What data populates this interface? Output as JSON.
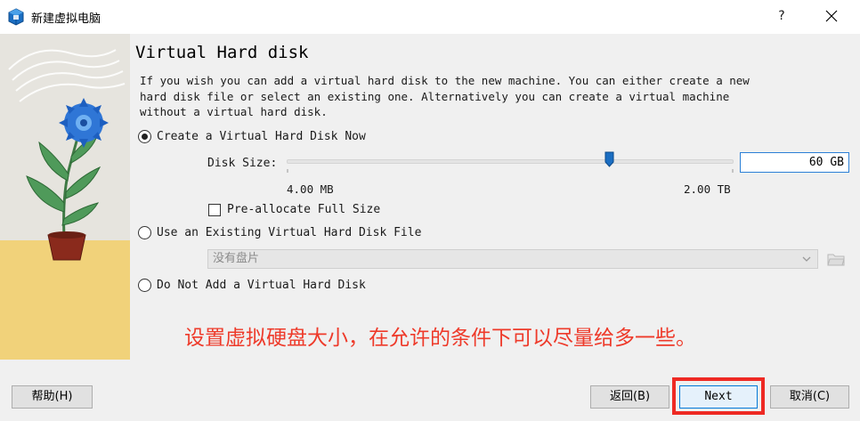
{
  "window": {
    "title": "新建虚拟电脑",
    "help_label": "?",
    "icons": {
      "app": "virtualbox-icon",
      "close": "close-icon"
    }
  },
  "page": {
    "heading": "Virtual Hard disk",
    "description": "If you wish you can add a virtual hard disk to the new machine. You can either create a new hard disk file or select an existing one. Alternatively you can create a virtual machine without a virtual hard disk."
  },
  "options": {
    "create_new": {
      "label": "Create a Virtual Hard Disk Now",
      "selected": true
    },
    "use_existing": {
      "label": "Use an Existing Virtual Hard Disk File",
      "selected": false
    },
    "no_disk": {
      "label": "Do Not Add a Virtual Hard Disk",
      "selected": false
    }
  },
  "disk_size": {
    "label": "Disk Size:",
    "value": "60 GB",
    "min_label": "4.00 MB",
    "max_label": "2.00 TB",
    "slider_position": 0.72
  },
  "preallocate": {
    "label": "Pre-allocate Full Size",
    "checked": false
  },
  "existing_file_select": {
    "value": "没有盘片",
    "enabled": false
  },
  "annotation": "设置虚拟硬盘大小，在允许的条件下可以尽量给多一些。",
  "buttons": {
    "help": "帮助(H)",
    "back": "返回(B)",
    "next": "Next",
    "cancel": "取消(C)"
  },
  "colors": {
    "accent": "#2b7fd6",
    "annotation": "#ee3a2a",
    "highlight_border": "#ee2a24"
  }
}
